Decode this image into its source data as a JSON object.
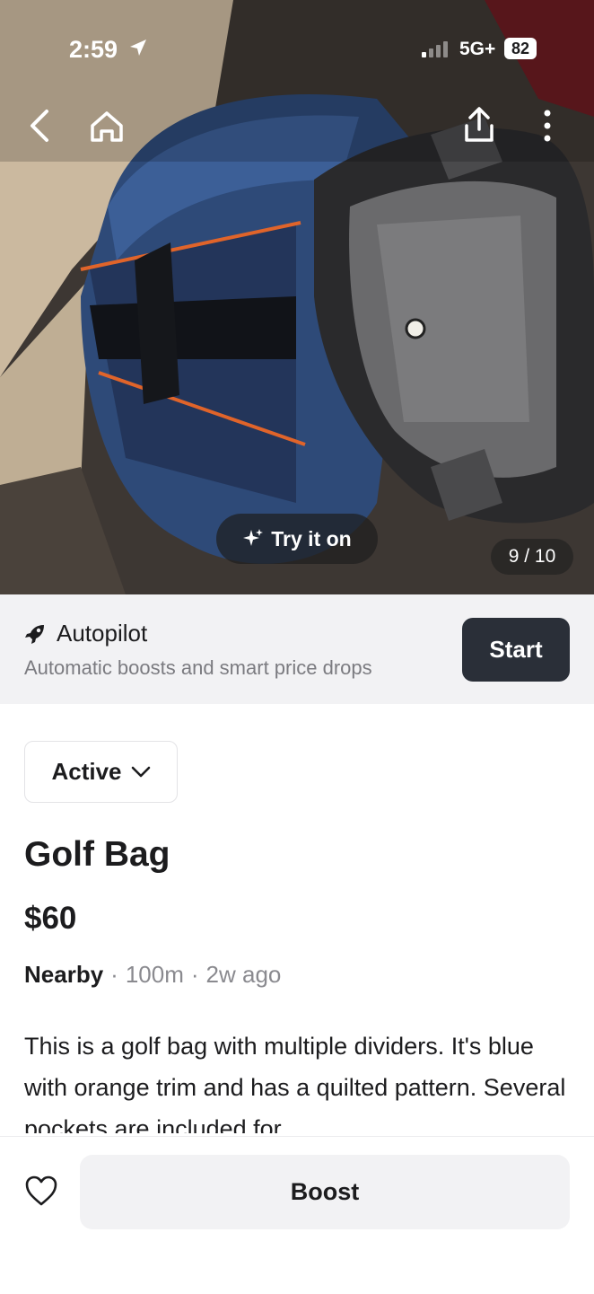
{
  "status_bar": {
    "time": "2:59",
    "network": "5G+",
    "battery": "82"
  },
  "photo": {
    "try_on_label": "Try it on",
    "counter": "9 / 10"
  },
  "autopilot": {
    "title": "Autopilot",
    "subtitle": "Automatic boosts and smart price drops",
    "start_label": "Start"
  },
  "listing": {
    "status": "Active",
    "title": "Golf Bag",
    "price": "$60",
    "location": "Nearby",
    "distance": "100m",
    "posted": "2w ago",
    "description": "This is a golf bag with multiple dividers. It's blue with orange trim and has a quilted pattern. Several pockets are included for"
  },
  "bottom_bar": {
    "boost_label": "Boost"
  },
  "icons": [
    "back-icon",
    "home-icon",
    "share-icon",
    "more-icon",
    "sparkle-icon",
    "rocket-icon",
    "chevron-down-icon",
    "heart-icon"
  ]
}
